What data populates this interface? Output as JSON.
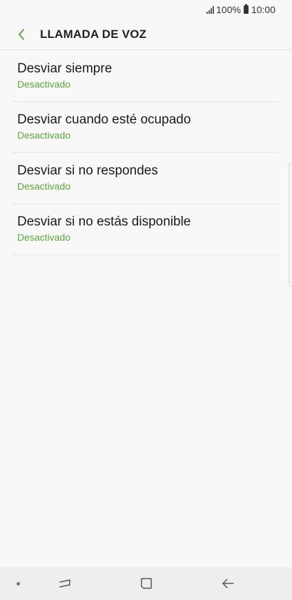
{
  "status_bar": {
    "battery": "100%",
    "time": "10:00"
  },
  "header": {
    "title": "LLAMADA DE VOZ",
    "back_icon": "chevron-left-icon"
  },
  "colors": {
    "accent": "#5aa63a",
    "background": "#f8f8f8",
    "nav_background": "#eeeeee"
  },
  "items": [
    {
      "title": "Desviar siempre",
      "status": "Desactivado"
    },
    {
      "title": "Desviar cuando esté ocupado",
      "status": "Desactivado"
    },
    {
      "title": "Desviar si no respondes",
      "status": "Desactivado"
    },
    {
      "title": "Desviar si no estás disponible",
      "status": "Desactivado"
    }
  ],
  "nav_bar": {
    "icons": [
      "dot-indicator-icon",
      "recent-apps-icon",
      "home-icon",
      "back-arrow-icon"
    ]
  }
}
